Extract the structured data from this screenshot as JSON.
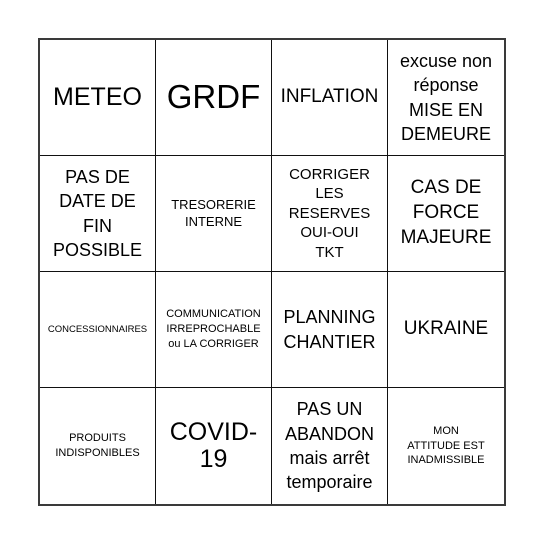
{
  "board": {
    "cells": [
      {
        "text": "METEO"
      },
      {
        "text": "GRDF"
      },
      {
        "text": "INFLATION"
      },
      {
        "text": "excuse non\nréponse\nMISE EN\nDEMEURE"
      },
      {
        "text": "PAS DE\nDATE DE\nFIN\nPOSSIBLE"
      },
      {
        "text": "TRESORERIE\nINTERNE"
      },
      {
        "text": "CORRIGER\nLES\nRESERVES\nOUI-OUI\nTKT"
      },
      {
        "text": "CAS DE\nFORCE\nMAJEURE"
      },
      {
        "text": "CONCESSIONNAIRES"
      },
      {
        "text": "COMMUNICATION\nIRREPROCHABLE\nou LA CORRIGER"
      },
      {
        "text": "PLANNING\nCHANTIER"
      },
      {
        "text": "UKRAINE"
      },
      {
        "text": "PRODUITS\nINDISPONIBLES"
      },
      {
        "text": "COVID-\n19"
      },
      {
        "text": "PAS UN\nABANDON\nmais arrêt\ntemporaire"
      },
      {
        "text": "MON\nATTITUDE EST\nINADMISSIBLE"
      }
    ]
  }
}
